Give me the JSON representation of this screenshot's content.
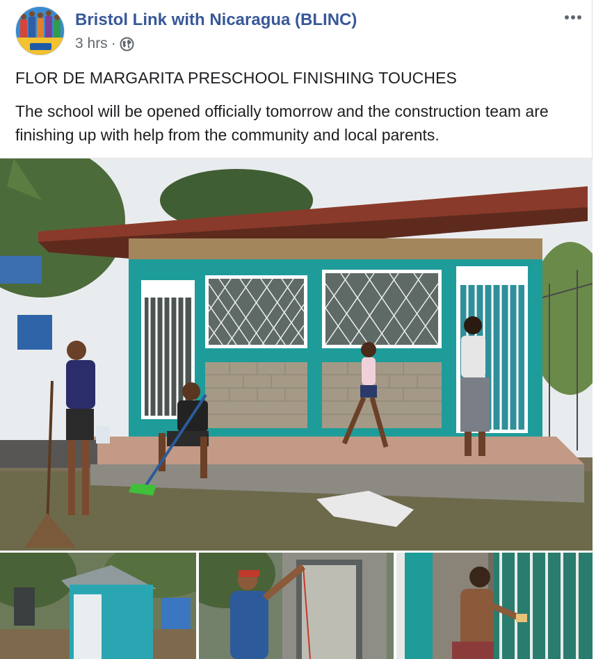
{
  "post": {
    "page_name": "Bristol Link with Nicaragua (BLINC)",
    "time_ago": "3 hrs",
    "separator": "·",
    "privacy_icon": "globe-icon",
    "more_icon": "more-options-icon",
    "avatar": {
      "alt": "BLINC logo",
      "text": "BLINC"
    },
    "title": "FLOR DE MARGARITA PRESCHOOL FINISHING TOUCHES",
    "body": "The school will be opened officially tomorrow and the construction team are finishing up with help from the community and local parents."
  },
  "photos": {
    "main": "preschool-building-photo",
    "thumbnails": [
      "latrine-photo",
      "man-painting-photo",
      "man-sanding-gate-photo"
    ]
  },
  "colors": {
    "link": "#385898",
    "text": "#1c1e21",
    "meta": "#616770",
    "wall_turquoise": "#1e9c9a",
    "roof": "#8a3a2a"
  }
}
